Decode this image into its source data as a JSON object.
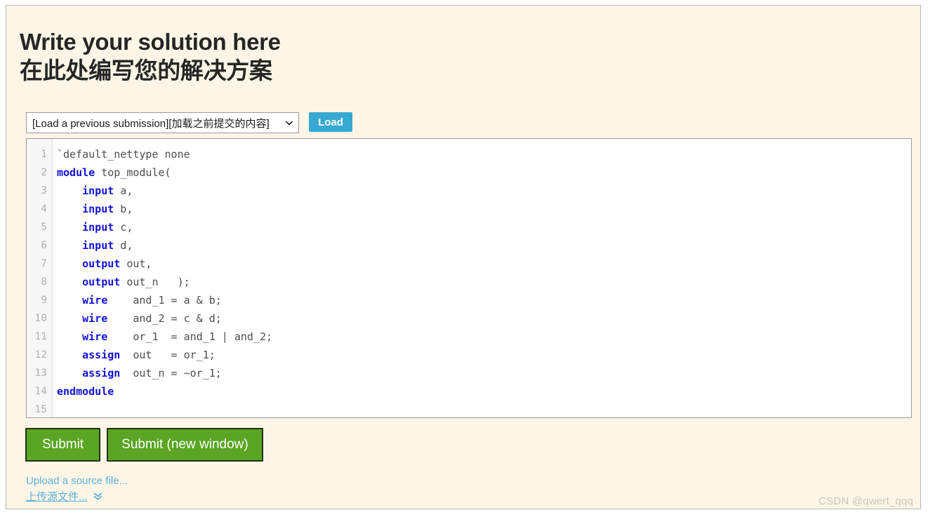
{
  "heading": {
    "line1": "Write your solution here",
    "line2": "在此处编写您的解决方案"
  },
  "load_row": {
    "select_value": "[Load a previous submission][加载之前提交的内容]",
    "select_options": [
      "[Load a previous submission][加载之前提交的内容]"
    ],
    "caret_icon": "chevron-down-icon",
    "load_label": "Load",
    "load_button_color": "#37a9d2"
  },
  "editor": {
    "line_numbers": [
      "1",
      "2",
      "3",
      "4",
      "5",
      "6",
      "7",
      "8",
      "9",
      "10",
      "11",
      "12",
      "13",
      "14",
      "15"
    ],
    "keyword_color": "#1212d9",
    "text_color": "#4d4d4d",
    "lines": [
      {
        "n": "1",
        "segments": [
          {
            "t": "`default_nettype none",
            "k": false
          }
        ]
      },
      {
        "n": "2",
        "segments": [
          {
            "t": "module",
            "k": true
          },
          {
            "t": " top_module(",
            "k": false
          }
        ]
      },
      {
        "n": "3",
        "segments": [
          {
            "t": "    ",
            "k": false
          },
          {
            "t": "input",
            "k": true
          },
          {
            "t": " a,",
            "k": false
          }
        ]
      },
      {
        "n": "4",
        "segments": [
          {
            "t": "    ",
            "k": false
          },
          {
            "t": "input",
            "k": true
          },
          {
            "t": " b,",
            "k": false
          }
        ]
      },
      {
        "n": "5",
        "segments": [
          {
            "t": "    ",
            "k": false
          },
          {
            "t": "input",
            "k": true
          },
          {
            "t": " c,",
            "k": false
          }
        ]
      },
      {
        "n": "6",
        "segments": [
          {
            "t": "    ",
            "k": false
          },
          {
            "t": "input",
            "k": true
          },
          {
            "t": " d,",
            "k": false
          }
        ]
      },
      {
        "n": "7",
        "segments": [
          {
            "t": "    ",
            "k": false
          },
          {
            "t": "output",
            "k": true
          },
          {
            "t": " out,",
            "k": false
          }
        ]
      },
      {
        "n": "8",
        "segments": [
          {
            "t": "    ",
            "k": false
          },
          {
            "t": "output",
            "k": true
          },
          {
            "t": " out_n   );",
            "k": false
          }
        ]
      },
      {
        "n": "9",
        "segments": [
          {
            "t": "    ",
            "k": false
          },
          {
            "t": "wire",
            "k": true
          },
          {
            "t": "    and_1 = a & b;",
            "k": false
          }
        ]
      },
      {
        "n": "10",
        "segments": [
          {
            "t": "    ",
            "k": false
          },
          {
            "t": "wire",
            "k": true
          },
          {
            "t": "    and_2 = c & d;",
            "k": false
          }
        ]
      },
      {
        "n": "11",
        "segments": [
          {
            "t": "    ",
            "k": false
          },
          {
            "t": "wire",
            "k": true
          },
          {
            "t": "    or_1  = and_1 | and_2;",
            "k": false
          }
        ]
      },
      {
        "n": "12",
        "segments": [
          {
            "t": "    ",
            "k": false
          },
          {
            "t": "assign",
            "k": true
          },
          {
            "t": "  out   = or_1;",
            "k": false
          }
        ]
      },
      {
        "n": "13",
        "segments": [
          {
            "t": "    ",
            "k": false
          },
          {
            "t": "assign",
            "k": true
          },
          {
            "t": "  out_n = ~or_1;",
            "k": false
          }
        ]
      },
      {
        "n": "14",
        "segments": [
          {
            "t": "endmodule",
            "k": true
          }
        ]
      },
      {
        "n": "15",
        "segments": [
          {
            "t": "",
            "k": false
          }
        ]
      }
    ]
  },
  "buttons": {
    "submit_label": "Submit",
    "submit_new_window_label": "Submit (new window)",
    "color": "#5aa523"
  },
  "uploads": {
    "en_label": "Upload a source file...",
    "cn_label": "上传源文件...",
    "chevron_icon": "double-chevron-down-icon",
    "link_color": "#5bb0dd"
  },
  "watermark": {
    "text": "CSDN @qwert_qqq"
  }
}
